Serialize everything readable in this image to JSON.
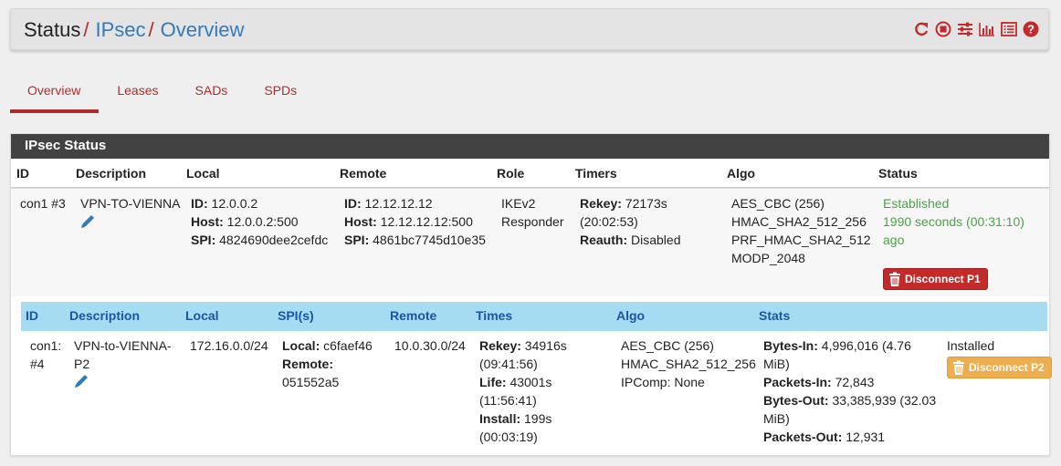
{
  "breadcrumb": {
    "root": "Status",
    "sep1": "/",
    "l1": "IPsec",
    "sep2": "/",
    "l2": "Overview"
  },
  "header_icons": [
    "reload-icon",
    "stop-icon",
    "sliders-icon",
    "chart-icon",
    "list-icon",
    "help-icon"
  ],
  "tabs": [
    {
      "label": "Overview",
      "active": true
    },
    {
      "label": "Leases"
    },
    {
      "label": "SADs"
    },
    {
      "label": "SPDs"
    }
  ],
  "panel": {
    "title": "IPsec Status",
    "p1_headers": [
      "ID",
      "Description",
      "Local",
      "Remote",
      "Role",
      "Timers",
      "Algo",
      "Status"
    ],
    "p1": {
      "id": "con1 #3",
      "desc": "VPN-TO-VIENNA",
      "local": {
        "id_k": "ID:",
        "id_v": " 12.0.0.2",
        "host_k": "Host:",
        "host_v": " 12.0.0.2:500",
        "spi_k": "SPI:",
        "spi_v": " 4824690dee2cefdc"
      },
      "remote": {
        "id_k": "ID:",
        "id_v": " 12.12.12.12",
        "host_k": "Host:",
        "host_v": " 12.12.12.12:500",
        "spi_k": "SPI:",
        "spi_v": " 4861bc7745d10e35"
      },
      "role": [
        "IKEv2",
        "Responder"
      ],
      "timers": {
        "rekey_k": "Rekey:",
        "rekey_v": " 72173s",
        "rekey_t": "(20:02:53)",
        "reauth_k": "Reauth:",
        "reauth_v": " Disabled"
      },
      "algo": [
        "AES_CBC (256)",
        "HMAC_SHA2_512_256",
        "PRF_HMAC_SHA2_512",
        "MODP_2048"
      ],
      "status": [
        "Established",
        "1990 seconds (00:31:10)",
        "ago"
      ],
      "btn": "Disconnect P1"
    },
    "p2_headers": [
      "ID",
      "Description",
      "Local",
      "SPI(s)",
      "Remote",
      "Times",
      "Algo",
      "Stats"
    ],
    "p2": {
      "id": [
        "con1:",
        "#4"
      ],
      "desc": [
        "VPN-to-VIENNA-",
        "P2"
      ],
      "local": "172.16.0.0/24",
      "spi": {
        "local_k": "Local:",
        "local_v": " c6faef46",
        "remote_k": "Remote:",
        "remote_v": "051552a5"
      },
      "remote": "10.0.30.0/24",
      "times": {
        "rekey_k": "Rekey:",
        "rekey_v": " 34916s",
        "rekey_t": "(09:41:56)",
        "life_k": "Life:",
        "life_v": " 43001s",
        "life_t": "(11:56:41)",
        "install_k": "Install:",
        "install_v": " 199s",
        "install_t": "(00:03:19)"
      },
      "algo": [
        "AES_CBC (256)",
        "HMAC_SHA2_512_256",
        "IPComp: None"
      ],
      "stats": {
        "bin_k": "Bytes-In:",
        "bin_v": " 4,996,016 (4.76",
        "bin_v2": "MiB)",
        "pin_k": "Packets-In:",
        "pin_v": " 72,843",
        "bout_k": "Bytes-Out:",
        "bout_v": " 33,385,939 (32.03",
        "bout_v2": "MiB)",
        "pout_k": "Packets-Out:",
        "pout_v": " 12,931"
      },
      "status": "Installed",
      "btn": "Disconnect P2"
    }
  }
}
